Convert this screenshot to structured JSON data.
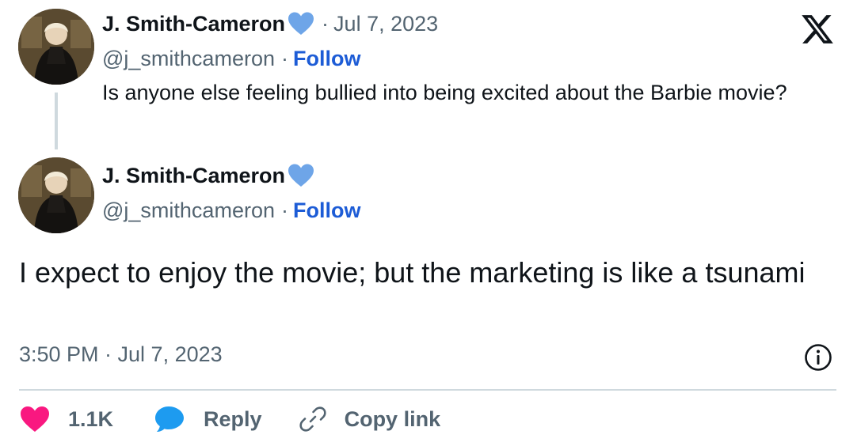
{
  "parent_tweet": {
    "author_name": "J. Smith-Cameron",
    "date": "Jul 7, 2023",
    "handle": "@j_smithcameron",
    "follow_label": "Follow",
    "separator": "·",
    "text": "Is anyone else feeling bullied into being excited about the Barbie movie?"
  },
  "main_tweet": {
    "author_name": "J. Smith-Cameron",
    "handle": "@j_smithcameron",
    "follow_label": "Follow",
    "separator": "·",
    "text": "I expect to enjoy the movie; but the marketing is like a tsunami",
    "timestamp": "3:50 PM · Jul 7, 2023"
  },
  "actions": {
    "like_count": "1.1K",
    "reply_label": "Reply",
    "copy_link_label": "Copy link"
  },
  "icons": {
    "verified": "blue-heart-icon",
    "platform": "x-logo-icon",
    "info": "info-icon",
    "like": "heart-icon",
    "reply": "speech-bubble-icon",
    "copy": "link-icon"
  },
  "colors": {
    "text_primary": "#0f1419",
    "text_secondary": "#536471",
    "follow_link": "#1d5cd6",
    "verified_heart": "#6ea5e8",
    "like_heart": "#f91880",
    "reply_bubble": "#1d9bf0",
    "divider": "#cfd9de"
  }
}
